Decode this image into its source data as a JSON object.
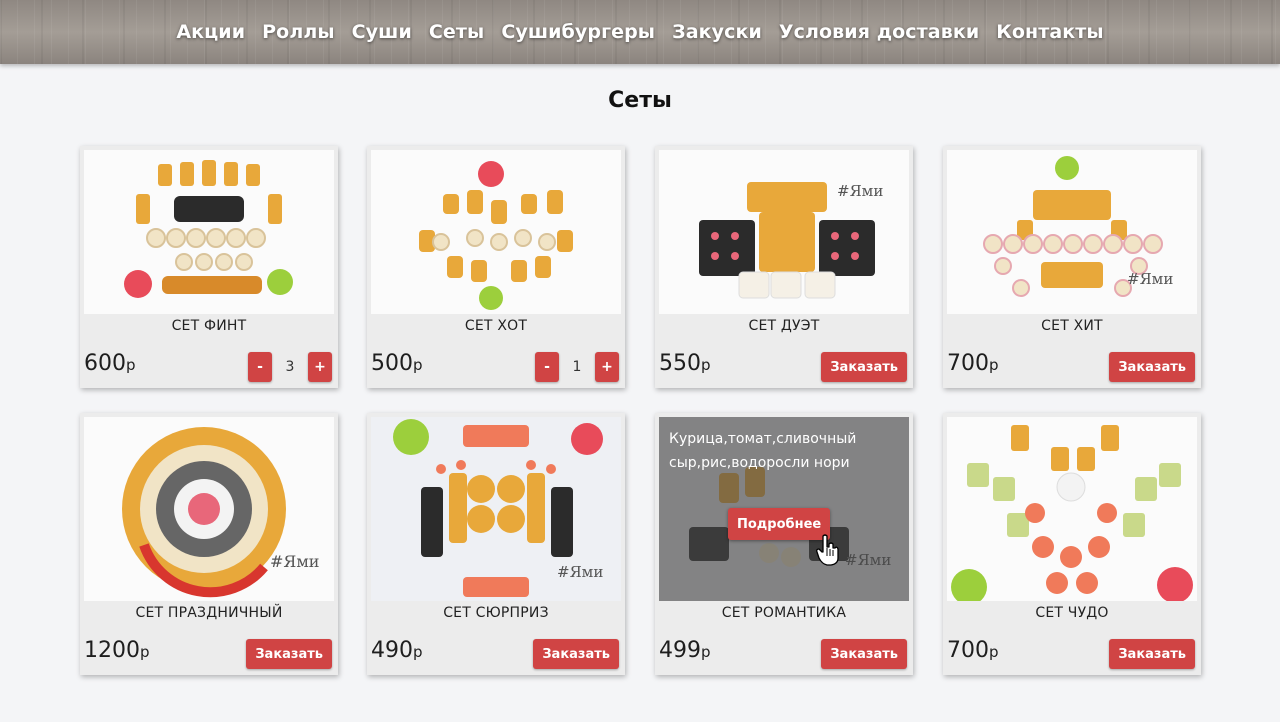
{
  "nav": {
    "items": [
      "Акции",
      "Роллы",
      "Суши",
      "Сеты",
      "Сушибургеры",
      "Закуски",
      "Условия доставки",
      "Контакты"
    ]
  },
  "page": {
    "title": "Сеты"
  },
  "products": [
    {
      "name": "СЕТ ФИНТ",
      "price": "600",
      "currency": "р",
      "action": "stepper",
      "qty": "3",
      "minus": "-",
      "plus": "+"
    },
    {
      "name": "СЕТ ХОТ",
      "price": "500",
      "currency": "р",
      "action": "stepper",
      "qty": "1",
      "minus": "-",
      "plus": "+"
    },
    {
      "name": "СЕТ ДУЭТ",
      "price": "550",
      "currency": "р",
      "action": "order",
      "order_label": "Заказать"
    },
    {
      "name": "СЕТ ХИТ",
      "price": "700",
      "currency": "р",
      "action": "order",
      "order_label": "Заказать"
    },
    {
      "name": "СЕТ ПРАЗДНИЧНЫЙ",
      "price": "1200",
      "currency": "р",
      "action": "order",
      "order_label": "Заказать"
    },
    {
      "name": "СЕТ СЮРПРИЗ",
      "price": "490",
      "currency": "р",
      "action": "order",
      "order_label": "Заказать"
    },
    {
      "name": "СЕТ РОМАНТИКА",
      "price": "499",
      "currency": "р",
      "action": "order",
      "order_label": "Заказать",
      "hover": {
        "description": "Курица,томат,сливочный сыр,рис,водоросли нори",
        "more_label": "Подробнее"
      }
    },
    {
      "name": "СЕТ ЧУДО",
      "price": "700",
      "currency": "р",
      "action": "order",
      "order_label": "Заказать"
    }
  ],
  "theme": {
    "accent": "#d04444",
    "card_bg": "#ececec",
    "page_bg": "#f4f5f7"
  }
}
